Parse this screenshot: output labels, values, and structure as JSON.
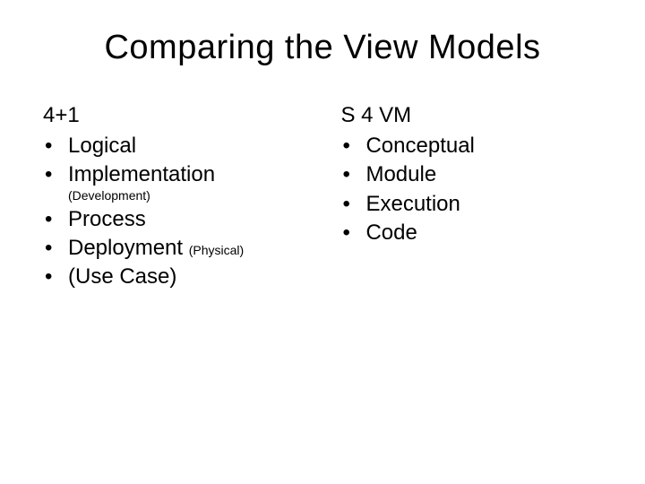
{
  "title": "Comparing the View Models",
  "left": {
    "heading": "4+1",
    "items": [
      {
        "text": "Logical"
      },
      {
        "text": "Implementation",
        "subnote": "(Development)"
      },
      {
        "text": "Process"
      },
      {
        "text": "Deployment",
        "inline_small": "(Physical)"
      },
      {
        "text": "(Use Case)"
      }
    ]
  },
  "right": {
    "heading": "S 4 VM",
    "items": [
      {
        "text": "Conceptual"
      },
      {
        "text": "Module"
      },
      {
        "text": "Execution"
      },
      {
        "text": "Code"
      }
    ]
  },
  "bullet_char": "•"
}
